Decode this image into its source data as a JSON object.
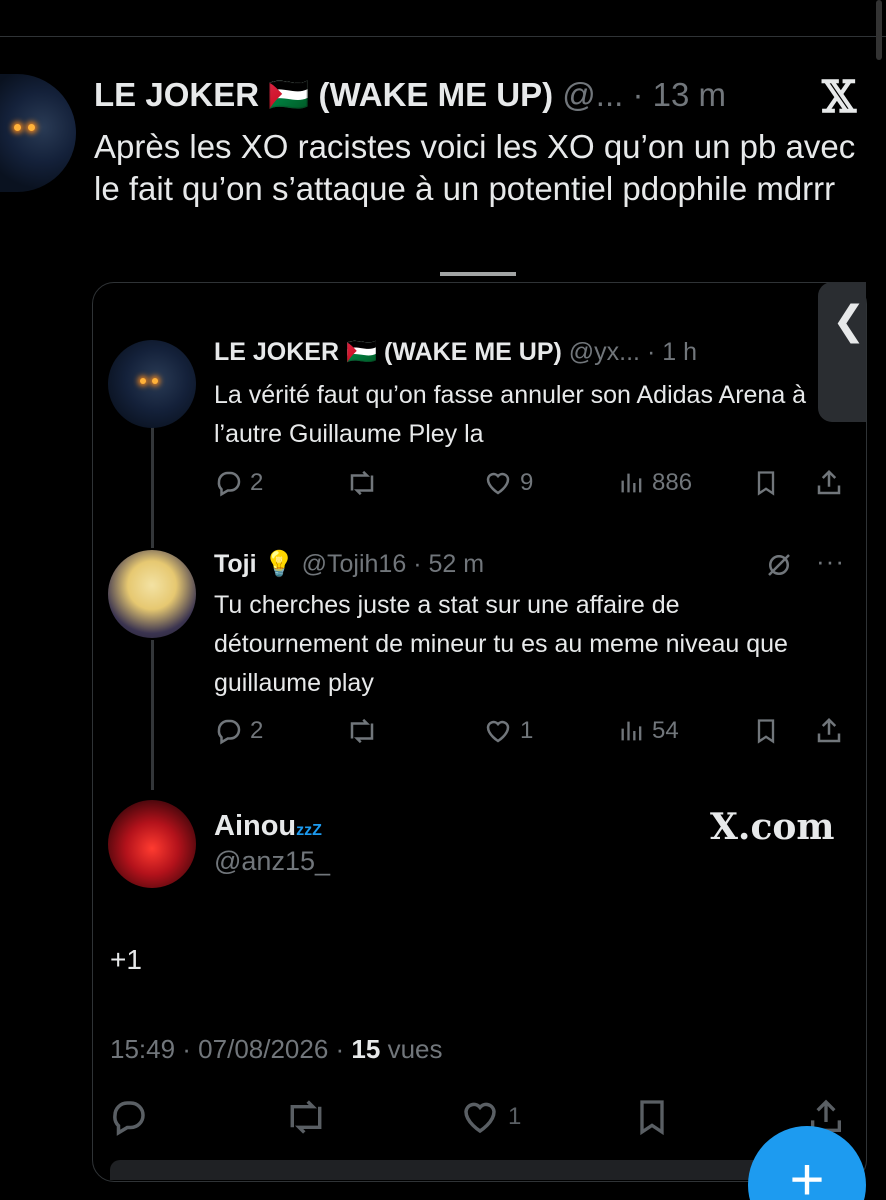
{
  "main_tweet": {
    "author_name": "LE JOKER 🇵🇸 (WAKE ME UP)",
    "handle": "@...",
    "time": "13 m",
    "text": "Après les XO racistes voici les XO qu’on un pb avec le fait qu’on s’attaque à un potentiel pdophile mdrrr"
  },
  "quoted_thread": {
    "tweets": [
      {
        "author_name": "LE JOKER 🇵🇸 (WAKE ME UP)",
        "handle": "@yx...",
        "time": "1 h",
        "text": "La vérité faut qu’on fasse annuler son Adidas Arena à l’autre Guillaume Pley la",
        "replies": "2",
        "likes": "9",
        "views": "886"
      },
      {
        "author_name": "Toji",
        "handle": "@Tojih16",
        "time": "52 m",
        "text": "Tu cherches juste a stat sur une affaire de détournement de mineur tu es au meme niveau que guillaume play",
        "replies": "2",
        "likes": "1",
        "views": "54"
      }
    ],
    "reply": {
      "author_name": "Ainou",
      "zz": "zzZ",
      "handle": "@anz15_",
      "site": "X.com",
      "text": "+1",
      "date": "15:49 · 07/08/2026 ·",
      "views_count": "15",
      "views_label": "vues",
      "likes": "1"
    }
  },
  "fab_label": "+",
  "colors": {
    "accent": "#1d9bf0",
    "background": "#000000",
    "muted": "#71767b"
  }
}
